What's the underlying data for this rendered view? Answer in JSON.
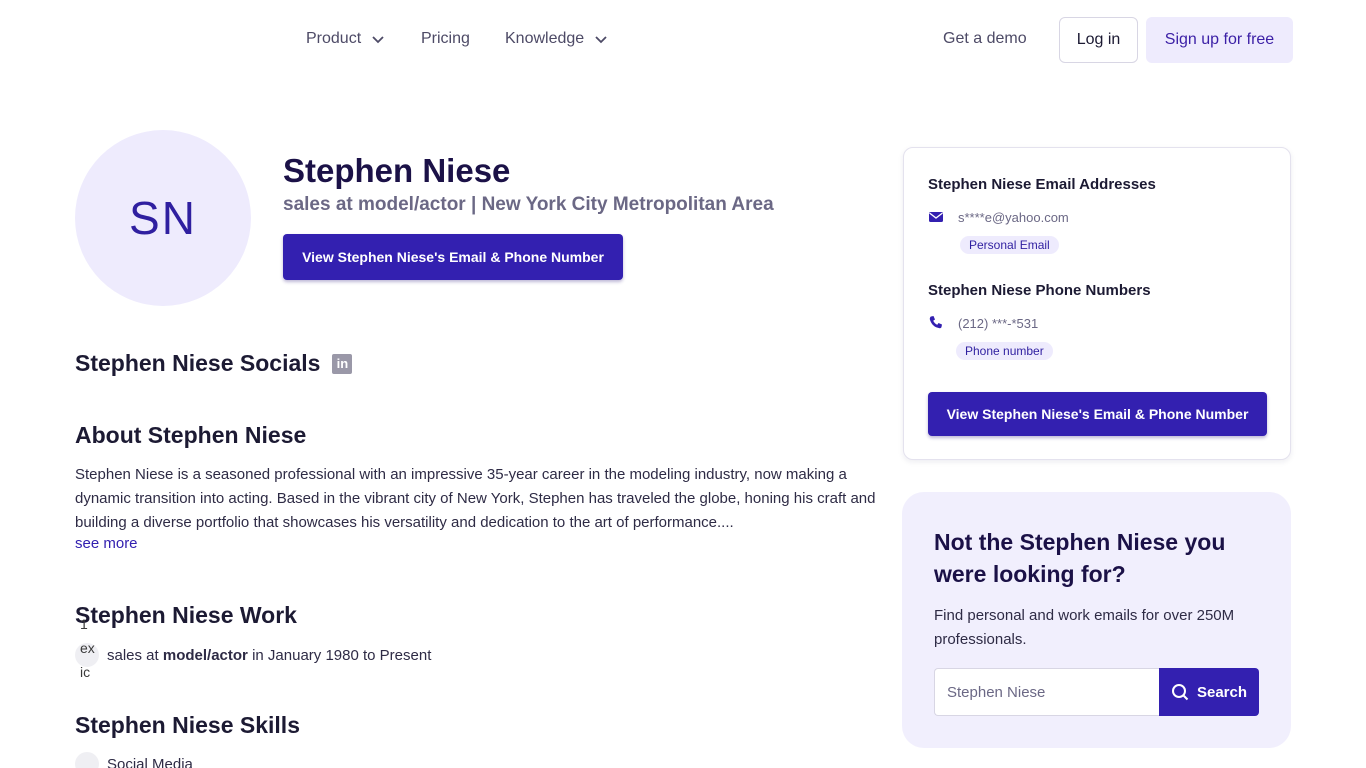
{
  "nav": {
    "product": "Product",
    "pricing": "Pricing",
    "knowledge": "Knowledge",
    "get_demo": "Get a demo",
    "login": "Log in",
    "signup": "Sign up for free"
  },
  "profile": {
    "initials": "SN",
    "name": "Stephen Niese",
    "subtitle": "sales at model/actor | New York City Metropolitan Area",
    "view_button": "View Stephen Niese's Email & Phone Number"
  },
  "socials": {
    "title": "Stephen Niese Socials",
    "icon": "linkedin-icon"
  },
  "about": {
    "title": "About Stephen Niese",
    "text": "Stephen Niese is a seasoned professional with an impressive 35-year career in the modeling industry, now making a dynamic transition into acting. Based in the vibrant city of New York, Stephen has traveled the globe, honing his craft and building a diverse portfolio that showcases his versatility and dedication to the art of performance....",
    "see_more": "see more"
  },
  "work": {
    "title": "Stephen Niese Work",
    "entry": {
      "role": "sales at ",
      "company": "model/actor",
      "period": " in January 1980 to Present"
    },
    "broken_image_alt": "1 ex ic"
  },
  "skills": {
    "title": "Stephen Niese Skills",
    "items": [
      "Social Media"
    ]
  },
  "contact_card": {
    "email_title": "Stephen Niese Email Addresses",
    "email_value": "s****e@yahoo.com",
    "email_badge": "Personal Email",
    "phone_title": "Stephen Niese Phone Numbers",
    "phone_value": "(212) ***-*531",
    "phone_badge": "Phone number",
    "view_button": "View Stephen Niese's Email & Phone Number"
  },
  "search_panel": {
    "title": "Not the Stephen Niese you were looking for?",
    "text": "Find personal and work emails for over 250M professionals.",
    "input_value": "Stephen Niese",
    "button": "Search"
  },
  "colors": {
    "accent": "#3320b0",
    "accent_light": "#eeebfd"
  }
}
